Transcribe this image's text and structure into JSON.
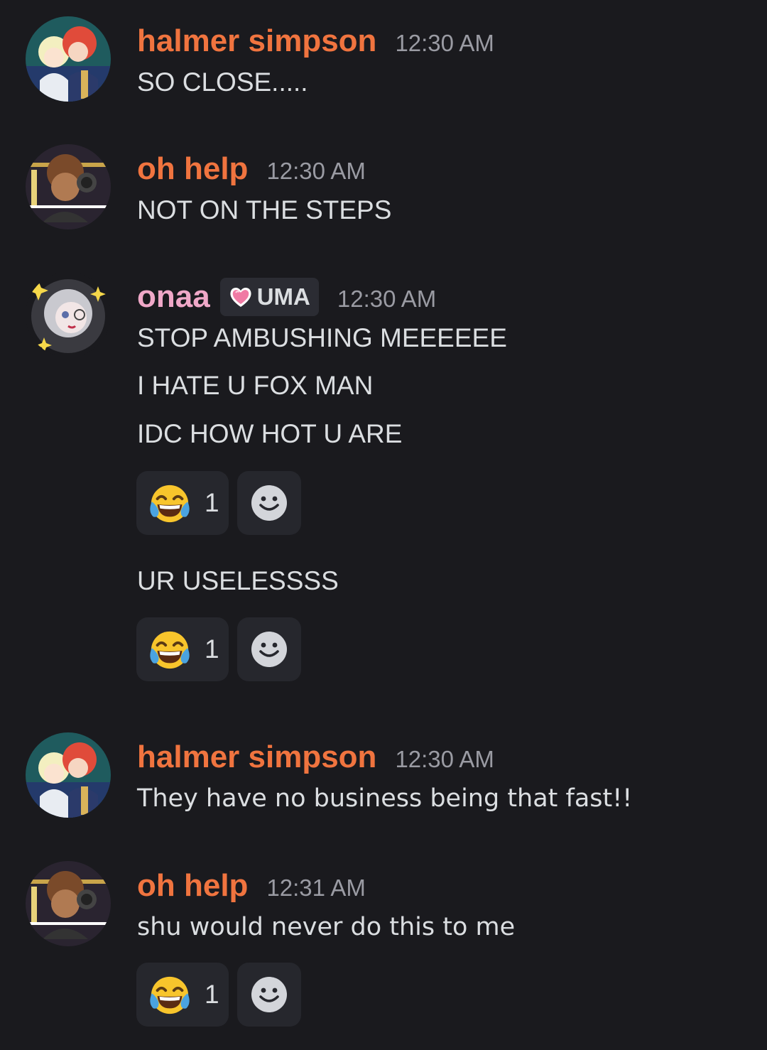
{
  "colors": {
    "background": "#1a1a1e",
    "username_orange": "#f0743f",
    "username_pink": "#f0a8c8",
    "timestamp": "#9a9ba3",
    "message_text": "#dbdee1",
    "reaction_bg": "#26272d"
  },
  "messages": [
    {
      "author": "halmer simpson",
      "author_color": "#f0743f",
      "timestamp": "12:30 AM",
      "lines": [
        "SO CLOSE....."
      ]
    },
    {
      "author": "oh help",
      "author_color": "#f0743f",
      "timestamp": "12:30 AM",
      "lines": [
        "NOT ON THE STEPS"
      ]
    },
    {
      "author": "onaa",
      "author_color": "#f0a8c8",
      "role_badge": {
        "icon": "pink-heart-icon",
        "label": "UMA"
      },
      "timestamp": "12:30 AM",
      "lines": [
        "STOP AMBUSHING MEEEEEE",
        "I HATE U FOX MAN",
        "IDC HOW HOT U ARE"
      ],
      "reaction": {
        "emoji": "face-with-tears-of-joy-icon",
        "count": "1"
      },
      "followup": {
        "text": "UR USELESSSS",
        "reaction": {
          "emoji": "face-with-tears-of-joy-icon",
          "count": "1"
        }
      }
    },
    {
      "author": "halmer simpson",
      "author_color": "#f0743f",
      "timestamp": "12:30 AM",
      "lines": [
        "They have no business being that fast!!"
      ]
    },
    {
      "author": "oh help",
      "author_color": "#f0743f",
      "timestamp": "12:31 AM",
      "lines": [
        "shu would never do this to me"
      ],
      "reaction": {
        "emoji": "face-with-tears-of-joy-icon",
        "count": "1"
      }
    }
  ]
}
